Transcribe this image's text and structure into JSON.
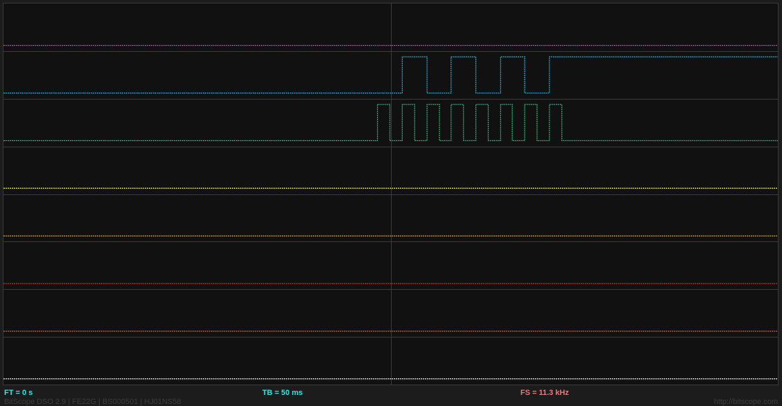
{
  "status": {
    "ft": "FT = 0 s",
    "tb": "TB = 50 ms",
    "fs": "FS = 11.3 kHz"
  },
  "footer": {
    "device": "BitScope DSO 2.9 | FE22G | BS000501 | HJ01NS58",
    "url": "http://bitscope.com"
  },
  "colors": {
    "background": "#111111",
    "grid": "#3c3c3c",
    "ft_text": "#2ee6e6",
    "tb_text": "#2ee6e6",
    "fs_text": "#f07878",
    "footer_text": "#3e3e3e"
  },
  "channels": [
    {
      "color": "#c040c0",
      "state": "low",
      "transitions": []
    },
    {
      "color": "#22aadd",
      "state": "low",
      "transitions": [
        0.515,
        0.547,
        0.578,
        0.61,
        0.642,
        0.673,
        0.705
      ]
    },
    {
      "color": "#22bb77",
      "state": "low",
      "transitions": [
        0.483,
        0.499,
        0.515,
        0.531,
        0.547,
        0.563,
        0.578,
        0.594,
        0.61,
        0.626,
        0.642,
        0.657,
        0.673,
        0.689,
        0.705,
        0.721
      ]
    },
    {
      "color": "#dddd33",
      "state": "low",
      "transitions": []
    },
    {
      "color": "#ee9922",
      "state": "low",
      "transitions": []
    },
    {
      "color": "#dd2222",
      "state": "low",
      "transitions": []
    },
    {
      "color": "#cc6633",
      "state": "low",
      "transitions": []
    },
    {
      "color": "#dddddd",
      "state": "low",
      "transitions": []
    }
  ]
}
